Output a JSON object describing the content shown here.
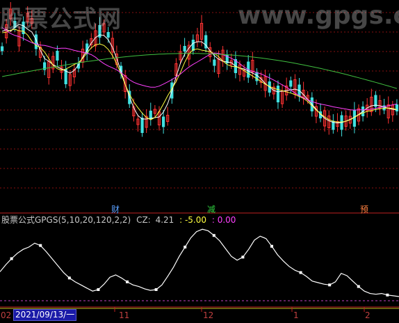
{
  "watermark": {
    "text": "股票公式网",
    "url": "www.gpgs.cc"
  },
  "badges": [
    {
      "label": "财",
      "color": "#5aa0ff"
    },
    {
      "label": "减",
      "color": "#30d040"
    },
    {
      "label": "预",
      "color": "#ff8040"
    }
  ],
  "indicator": {
    "name": "股票公式GPGS(5,10,20,120,2,2)",
    "cz_label": "CZ:",
    "cz_value": "4.21",
    "v2": ": -5.00",
    "v3": ": 0.00",
    "name_color": "#c8c8c8",
    "v2_color": "#ffff40",
    "v3_color": "#ff40ff"
  },
  "time_axis": {
    "labels": [
      "02",
      "11",
      "12",
      "1",
      "2"
    ],
    "cursor_date": "2021/09/13/一"
  },
  "colors": {
    "bg": "#000000",
    "grid": "#8a1010",
    "up": "#ff3232",
    "down": "#40e0e0",
    "ma5": "#ffffff",
    "ma10": "#ffff40",
    "ma20": "#ff40ff",
    "ma120": "#40c040"
  },
  "chart_data": {
    "type": "line",
    "series": [
      {
        "values": [
          3.2,
          4.1,
          4.9,
          5.6,
          6.1,
          6.4,
          6.9,
          6.6,
          5.8,
          4.9,
          4.0,
          3.1,
          2.4,
          1.9,
          1.5,
          1.1,
          0.7,
          0.9,
          1.6,
          2.5,
          2.8,
          2.4,
          1.9,
          1.5,
          1.3,
          1.0,
          0.8,
          0.9,
          1.5,
          2.6,
          3.8,
          5.2,
          6.4,
          7.6,
          8.4,
          8.7,
          8.5,
          7.9,
          7.2,
          6.2,
          5.2,
          4.7,
          5.1,
          6.1,
          7.3,
          7.8,
          7.5,
          6.5,
          5.4,
          4.6,
          3.9,
          3.4,
          3.1,
          2.6,
          2.0,
          1.8,
          1.6,
          1.5,
          1.9,
          3.0,
          2.7,
          2.0,
          1.3,
          0.7,
          0.4,
          0.3,
          0.4,
          0.2,
          0.1,
          0.0
        ]
      }
    ]
  }
}
